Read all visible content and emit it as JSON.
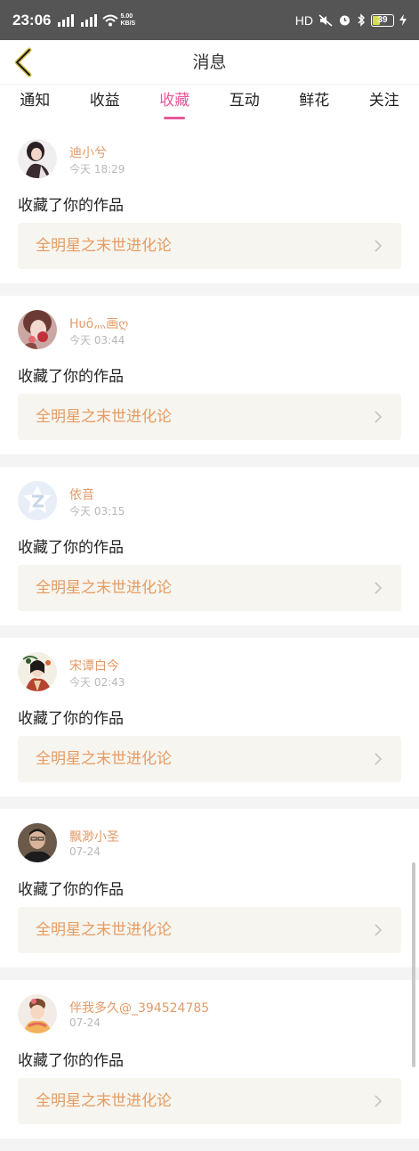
{
  "status_bar": {
    "time": "23:06",
    "net_speed_top": "5.00",
    "net_speed_bottom": "KB/S",
    "hd": "HD",
    "battery": "39"
  },
  "header": {
    "title": "消息"
  },
  "tabs": [
    {
      "label": "通知"
    },
    {
      "label": "收益"
    },
    {
      "label": "收藏"
    },
    {
      "label": "互动"
    },
    {
      "label": "鲜花"
    },
    {
      "label": "关注"
    }
  ],
  "active_tab": "收藏",
  "colors": {
    "accent": "#e8579a",
    "username": "#e39a66",
    "work_title": "#e69c62",
    "status_bar": "#555555"
  },
  "messages": [
    {
      "user": "迪小兮",
      "time": "今天 18:29",
      "action": "收藏了你的作品",
      "work": "全明星之末世进化论"
    },
    {
      "user": "Hυȏ灬画ღ",
      "time": "今天 03:44",
      "action": "收藏了你的作品",
      "work": "全明星之末世进化论"
    },
    {
      "user": "依音",
      "time": "今天 03:15",
      "action": "收藏了你的作品",
      "work": "全明星之末世进化论"
    },
    {
      "user": "宋谭白今",
      "time": "今天 02:43",
      "action": "收藏了你的作品",
      "work": "全明星之末世进化论"
    },
    {
      "user": "飘渺小圣",
      "time": "07-24",
      "action": "收藏了你的作品",
      "work": "全明星之末世进化论"
    },
    {
      "user": "伴我多久@_394524785",
      "time": "07-24",
      "action": "收藏了你的作品",
      "work": "全明星之末世进化论"
    }
  ]
}
